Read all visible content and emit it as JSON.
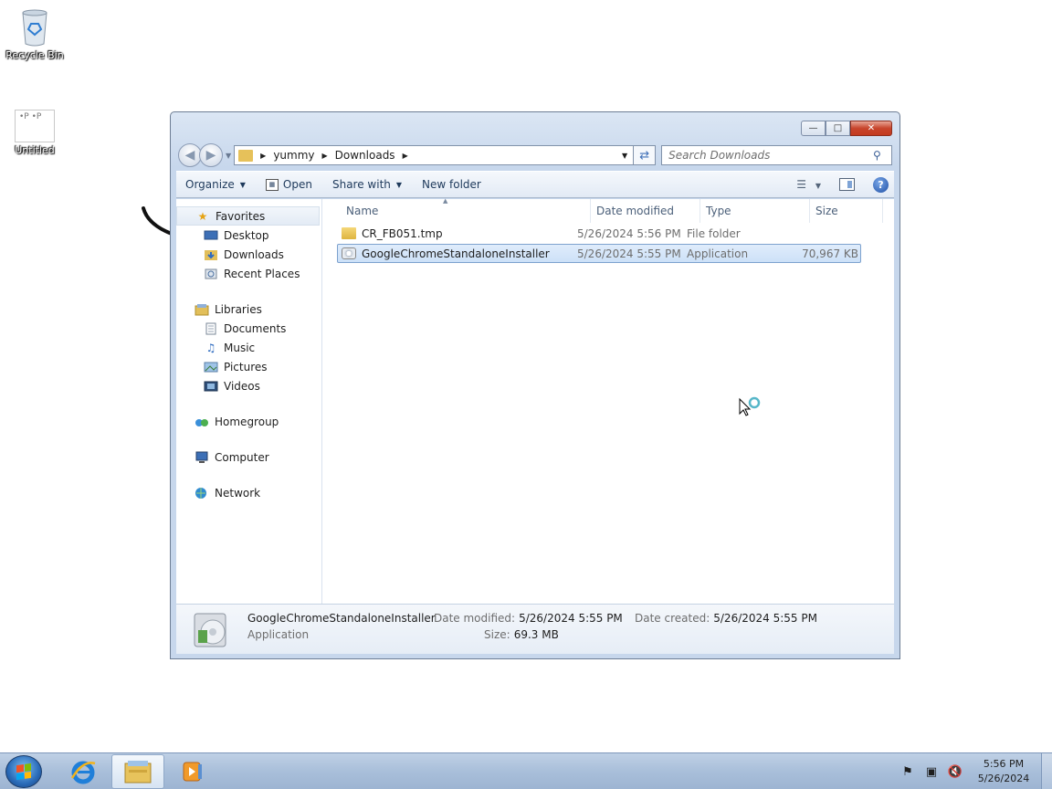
{
  "desktop": {
    "icons": [
      {
        "label": "Recycle Bin"
      },
      {
        "label": "Untitled",
        "thumb_text": "•P  •P"
      }
    ]
  },
  "window": {
    "title_buttons": {
      "minimize": "—",
      "maximize": "□",
      "close": "✕"
    },
    "address": {
      "crumbs": [
        "yummy",
        "Downloads"
      ],
      "search_placeholder": "Search Downloads"
    },
    "toolbar": {
      "organize": "Organize",
      "open": "Open",
      "share_with": "Share with",
      "new_folder": "New folder"
    },
    "nav": {
      "favorites": {
        "label": "Favorites",
        "items": [
          "Desktop",
          "Downloads",
          "Recent Places"
        ]
      },
      "libraries": {
        "label": "Libraries",
        "items": [
          "Documents",
          "Music",
          "Pictures",
          "Videos"
        ]
      },
      "homegroup": "Homegroup",
      "computer": "Computer",
      "network": "Network"
    },
    "columns": [
      "Name",
      "Date modified",
      "Type",
      "Size"
    ],
    "files": [
      {
        "name": "CR_FB051.tmp",
        "date": "5/26/2024 5:56 PM",
        "type": "File folder",
        "size": "",
        "icon": "folder-icon"
      },
      {
        "name": "GoogleChromeStandaloneInstaller",
        "date": "5/26/2024 5:55 PM",
        "type": "Application",
        "size": "70,967 KB",
        "icon": "application-icon",
        "selected": true
      }
    ],
    "details": {
      "name": "GoogleChromeStandaloneInstaller",
      "type": "Application",
      "date_modified_label": "Date modified:",
      "date_modified": "5/26/2024 5:55 PM",
      "date_created_label": "Date created:",
      "date_created": "5/26/2024 5:55 PM",
      "size_label": "Size:",
      "size": "69.3 MB"
    }
  },
  "taskbar": {
    "time": "5:56 PM",
    "date": "5/26/2024"
  }
}
